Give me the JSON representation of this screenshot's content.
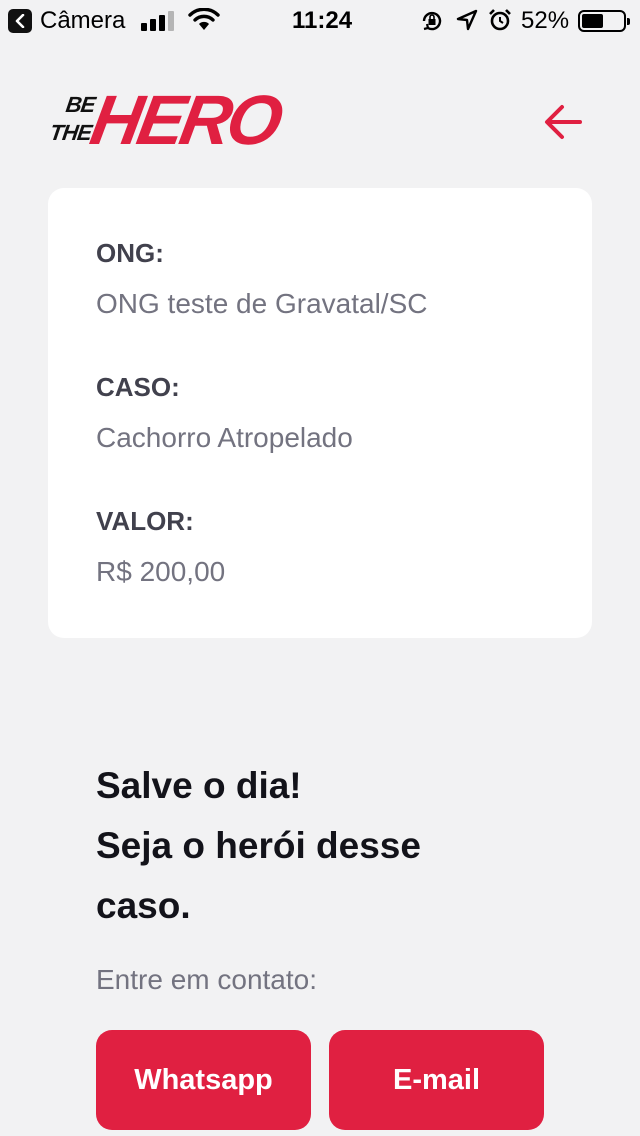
{
  "status_bar": {
    "back_app": "Câmera",
    "time": "11:24",
    "battery_percent_text": "52%",
    "battery_level": 0.52,
    "signal_bars_active": 3,
    "signal_bars_total": 4
  },
  "header": {
    "logo_be": "BE",
    "logo_the": "THE",
    "logo_hero": "HERO",
    "back_icon": "arrow-left-icon"
  },
  "incident": {
    "ong_label": "ONG:",
    "ong_value": "ONG teste de Gravatal/SC",
    "case_label": "CASO:",
    "case_value": "Cachorro Atropelado",
    "value_label": "VALOR:",
    "value_value": "R$ 200,00"
  },
  "contact": {
    "title_line1": "Salve o dia!",
    "title_line2": "Seja o herói desse",
    "title_line3": "caso.",
    "description": "Entre em contato:",
    "whatsapp_label": "Whatsapp",
    "email_label": "E-mail"
  },
  "colors": {
    "accent": "#e02041",
    "background": "#f2f2f3",
    "card": "#ffffff",
    "label_text": "#41414d",
    "value_text": "#737380",
    "title_text": "#13131a"
  }
}
